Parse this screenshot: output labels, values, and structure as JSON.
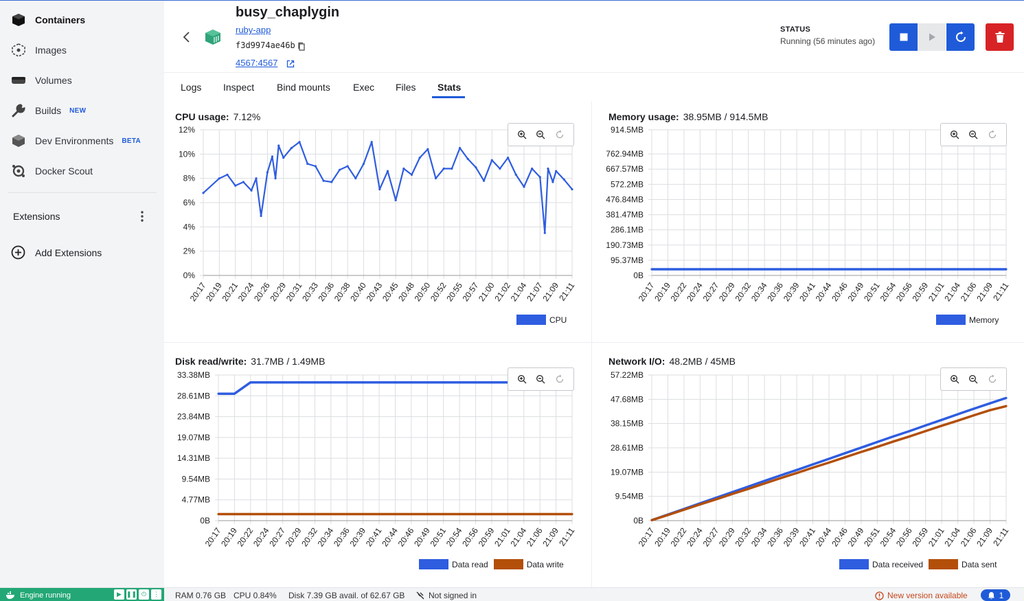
{
  "sidebar": {
    "items": [
      {
        "label": "Containers",
        "icon": "containers-icon",
        "active": true
      },
      {
        "label": "Images",
        "icon": "images-icon"
      },
      {
        "label": "Volumes",
        "icon": "volumes-icon"
      },
      {
        "label": "Builds",
        "icon": "builds-icon",
        "badge": "NEW"
      },
      {
        "label": "Dev Environments",
        "icon": "dev-environments-icon",
        "badge": "BETA"
      },
      {
        "label": "Docker Scout",
        "icon": "docker-scout-icon"
      }
    ],
    "extensions_label": "Extensions",
    "add_extensions_label": "Add Extensions"
  },
  "header": {
    "container_name": "busy_chaplygin",
    "image": "ruby-app",
    "id": "f3d9974ae46b",
    "port": "4567:4567",
    "status_label": "STATUS",
    "status_value": "Running (56 minutes ago)"
  },
  "tabs": [
    {
      "label": "Logs"
    },
    {
      "label": "Inspect"
    },
    {
      "label": "Bind mounts"
    },
    {
      "label": "Exec"
    },
    {
      "label": "Files"
    },
    {
      "label": "Stats",
      "active": true
    }
  ],
  "panels": {
    "cpu": {
      "title": "CPU usage:",
      "value": "7.12%",
      "legend": [
        "CPU"
      ]
    },
    "memory": {
      "title": "Memory usage:",
      "value": "38.95MB / 914.5MB",
      "legend": [
        "Memory"
      ]
    },
    "disk": {
      "title": "Disk read/write:",
      "value": "31.7MB / 1.49MB",
      "legend": [
        "Data read",
        "Data write"
      ]
    },
    "network": {
      "title": "Network I/O:",
      "value": "48.2MB / 45MB",
      "legend": [
        "Data received",
        "Data sent"
      ]
    }
  },
  "colors": {
    "accent": "#1f5bd9",
    "series_blue": "#2f5de0",
    "series_orange": "#b34f09",
    "danger": "#d72326",
    "engine": "#23a776"
  },
  "chart_data": [
    {
      "type": "line",
      "name": "cpu",
      "title": "CPU usage:",
      "xticks": [
        "20:17",
        "20:19",
        "20:21",
        "20:24",
        "20:26",
        "20:29",
        "20:31",
        "20:33",
        "20:36",
        "20:38",
        "20:40",
        "20:43",
        "20:45",
        "20:48",
        "20:50",
        "20:52",
        "20:55",
        "20:57",
        "21:00",
        "21:02",
        "21:04",
        "21:07",
        "21:09",
        "21:11"
      ],
      "yticks": [
        "0%",
        "2%",
        "4%",
        "6%",
        "8%",
        "10%",
        "12%"
      ],
      "ylim": [
        0,
        12
      ],
      "x": [
        0,
        1,
        1.5,
        2,
        2.5,
        3,
        3.3,
        3.6,
        4,
        4.3,
        4.5,
        4.7,
        5,
        5.5,
        6,
        6.5,
        7,
        7.5,
        8,
        8.5,
        9,
        9.5,
        10,
        10.5,
        11,
        11.5,
        12,
        12.5,
        13,
        13.5,
        14,
        14.5,
        15,
        15.5,
        16,
        16.5,
        17,
        17.5,
        18,
        18.5,
        19,
        19.5,
        20,
        20.5,
        21,
        21.3,
        21.5,
        21.8,
        22,
        22.5,
        23
      ],
      "series": [
        {
          "name": "CPU",
          "values": [
            6.8,
            8.0,
            8.3,
            7.4,
            7.7,
            7.0,
            8.0,
            4.9,
            8.5,
            9.8,
            8.0,
            10.7,
            9.7,
            10.5,
            11.0,
            9.2,
            9.0,
            7.8,
            7.7,
            8.7,
            9.0,
            8.0,
            9.2,
            11.0,
            7.1,
            8.6,
            6.2,
            8.8,
            8.3,
            9.7,
            10.4,
            8.0,
            8.8,
            8.8,
            10.5,
            9.6,
            8.9,
            7.8,
            9.5,
            8.8,
            9.7,
            8.3,
            7.3,
            8.8,
            8.1,
            3.5,
            8.8,
            7.7,
            8.6,
            7.9,
            7.1
          ]
        }
      ]
    },
    {
      "type": "line",
      "name": "memory",
      "title": "Memory usage:",
      "xticks": [
        "20:17",
        "20:19",
        "20:22",
        "20:24",
        "20:27",
        "20:29",
        "20:32",
        "20:34",
        "20:36",
        "20:39",
        "20:41",
        "20:44",
        "20:46",
        "20:49",
        "20:51",
        "20:54",
        "20:56",
        "20:59",
        "21:01",
        "21:04",
        "21:06",
        "21:09",
        "21:11"
      ],
      "yticks": [
        "0B",
        "95.37MB",
        "190.73MB",
        "286.1MB",
        "381.47MB",
        "476.84MB",
        "572.2MB",
        "667.57MB",
        "762.94MB",
        "914.5MB"
      ],
      "ylim": [
        0,
        914.5
      ],
      "series": [
        {
          "name": "Memory",
          "values": [
            38.9,
            38.9,
            38.9,
            38.9,
            38.9,
            38.9,
            38.9,
            38.9,
            38.9,
            38.9,
            38.9,
            38.9,
            38.9,
            38.9,
            38.9,
            38.9,
            38.9,
            38.9,
            38.9,
            38.9,
            38.9,
            38.9,
            38.95
          ]
        }
      ]
    },
    {
      "type": "line",
      "name": "disk",
      "title": "Disk read/write:",
      "xticks": [
        "20:17",
        "20:19",
        "20:22",
        "20:24",
        "20:27",
        "20:29",
        "20:32",
        "20:34",
        "20:36",
        "20:39",
        "20:41",
        "20:44",
        "20:46",
        "20:49",
        "20:51",
        "20:54",
        "20:56",
        "20:59",
        "21:01",
        "21:04",
        "21:06",
        "21:09",
        "21:11"
      ],
      "yticks": [
        "0B",
        "4.77MB",
        "9.54MB",
        "14.31MB",
        "19.07MB",
        "23.84MB",
        "28.61MB",
        "33.38MB"
      ],
      "ylim": [
        0,
        33.38
      ],
      "series": [
        {
          "name": "Data read",
          "values": [
            29.1,
            29.1,
            31.7,
            31.7,
            31.7,
            31.7,
            31.7,
            31.7,
            31.7,
            31.7,
            31.7,
            31.7,
            31.7,
            31.7,
            31.7,
            31.7,
            31.7,
            31.7,
            31.7,
            31.7,
            31.7,
            31.7,
            31.7
          ]
        },
        {
          "name": "Data write",
          "values": [
            1.49,
            1.49,
            1.49,
            1.49,
            1.49,
            1.49,
            1.49,
            1.49,
            1.49,
            1.49,
            1.49,
            1.49,
            1.49,
            1.49,
            1.49,
            1.49,
            1.49,
            1.49,
            1.49,
            1.49,
            1.49,
            1.49,
            1.49
          ]
        }
      ]
    },
    {
      "type": "line",
      "name": "network",
      "title": "Network I/O:",
      "xticks": [
        "20:17",
        "20:19",
        "20:22",
        "20:24",
        "20:27",
        "20:29",
        "20:32",
        "20:34",
        "20:36",
        "20:39",
        "20:41",
        "20:44",
        "20:46",
        "20:49",
        "20:51",
        "20:54",
        "20:56",
        "20:59",
        "21:01",
        "21:04",
        "21:06",
        "21:09",
        "21:11"
      ],
      "yticks": [
        "0B",
        "9.54MB",
        "19.07MB",
        "28.61MB",
        "38.15MB",
        "47.68MB",
        "57.22MB"
      ],
      "ylim": [
        0,
        57.22
      ],
      "series": [
        {
          "name": "Data received",
          "values": [
            0.2,
            2.4,
            4.6,
            6.8,
            9.0,
            11.2,
            13.4,
            15.6,
            17.8,
            19.9,
            22.1,
            24.3,
            26.5,
            28.7,
            30.9,
            33.1,
            35.2,
            37.4,
            39.6,
            41.8,
            44.0,
            46.1,
            48.2
          ]
        },
        {
          "name": "Data sent",
          "values": [
            0.2,
            2.2,
            4.3,
            6.4,
            8.4,
            10.5,
            12.5,
            14.6,
            16.7,
            18.7,
            20.8,
            22.8,
            24.9,
            27.0,
            29.0,
            31.1,
            33.1,
            35.2,
            37.3,
            39.3,
            41.4,
            43.4,
            45.0
          ]
        }
      ]
    }
  ],
  "footer": {
    "engine": "Engine running",
    "ram": "RAM 0.76 GB",
    "cpu": "CPU 0.84%",
    "disk": "Disk 7.39 GB avail. of 62.67 GB",
    "signin": "Not signed in",
    "new_version": "New version available",
    "notif_count": "1"
  }
}
